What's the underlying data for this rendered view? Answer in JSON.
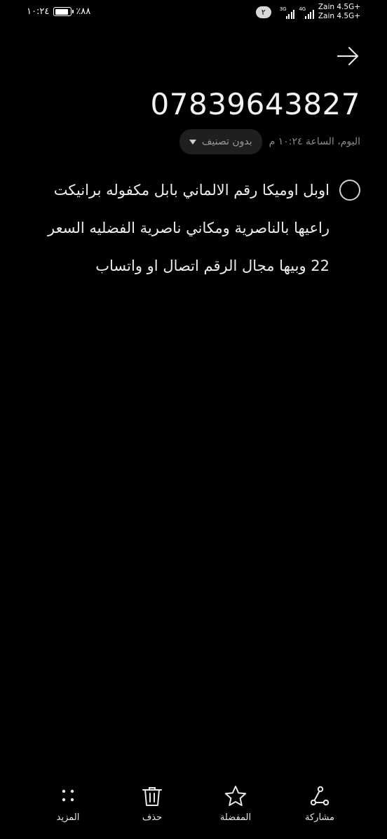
{
  "status_bar": {
    "time": "١٠:٢٤",
    "battery_percent_label": "٪٨٨",
    "battery_level": 0.88,
    "notification_count": "٢",
    "sim1_network": "3G",
    "sim2_network": "4G",
    "carrier1": "Zain 4.5G+",
    "carrier2": "Zain 4.5G+"
  },
  "header": {
    "title": "07839643827",
    "date": "اليوم، الساعة ١٠:٢٤ م",
    "category": "بدون تصنيف"
  },
  "note": {
    "text": "اوبل اوميكا رقم الالماني بابل مكفوله برانيكت راعيها بالناصرية ومكاني ناصرية الفضليه السعر 22 وبيها مجال الرقم اتصال او واتساب"
  },
  "toolbar": {
    "share_label": "مشاركة",
    "favorite_label": "المفضلة",
    "delete_label": "حذف",
    "more_label": "المزيد"
  },
  "colors": {
    "background": "#000000",
    "text_primary": "#ededed",
    "text_secondary": "#8a8a8a",
    "pill_background": "#1f1f1f"
  }
}
